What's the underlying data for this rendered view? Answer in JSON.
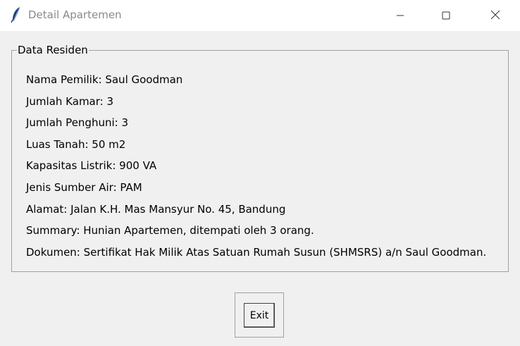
{
  "window": {
    "title": "Detail Apartemen",
    "app_icon": "feather-icon",
    "controls": {
      "minimize": "minimize-icon",
      "maximize": "maximize-icon",
      "close": "close-icon"
    }
  },
  "group": {
    "label": "Data Residen",
    "rows": [
      "Nama Pemilik: Saul Goodman",
      "Jumlah Kamar: 3",
      "Jumlah Penghuni: 3",
      "Luas Tanah: 50 m2",
      "Kapasitas Listrik: 900 VA",
      "Jenis Sumber Air: PAM",
      "Alamat: Jalan K.H. Mas Mansyur No. 45, Bandung",
      "Summary: Hunian Apartemen, ditempati oleh 3 orang.",
      "Dokumen: Sertifikat Hak Milik Atas Satuan Rumah Susun (SHMSRS) a/n Saul Goodman."
    ]
  },
  "buttons": {
    "exit_label": "Exit"
  }
}
